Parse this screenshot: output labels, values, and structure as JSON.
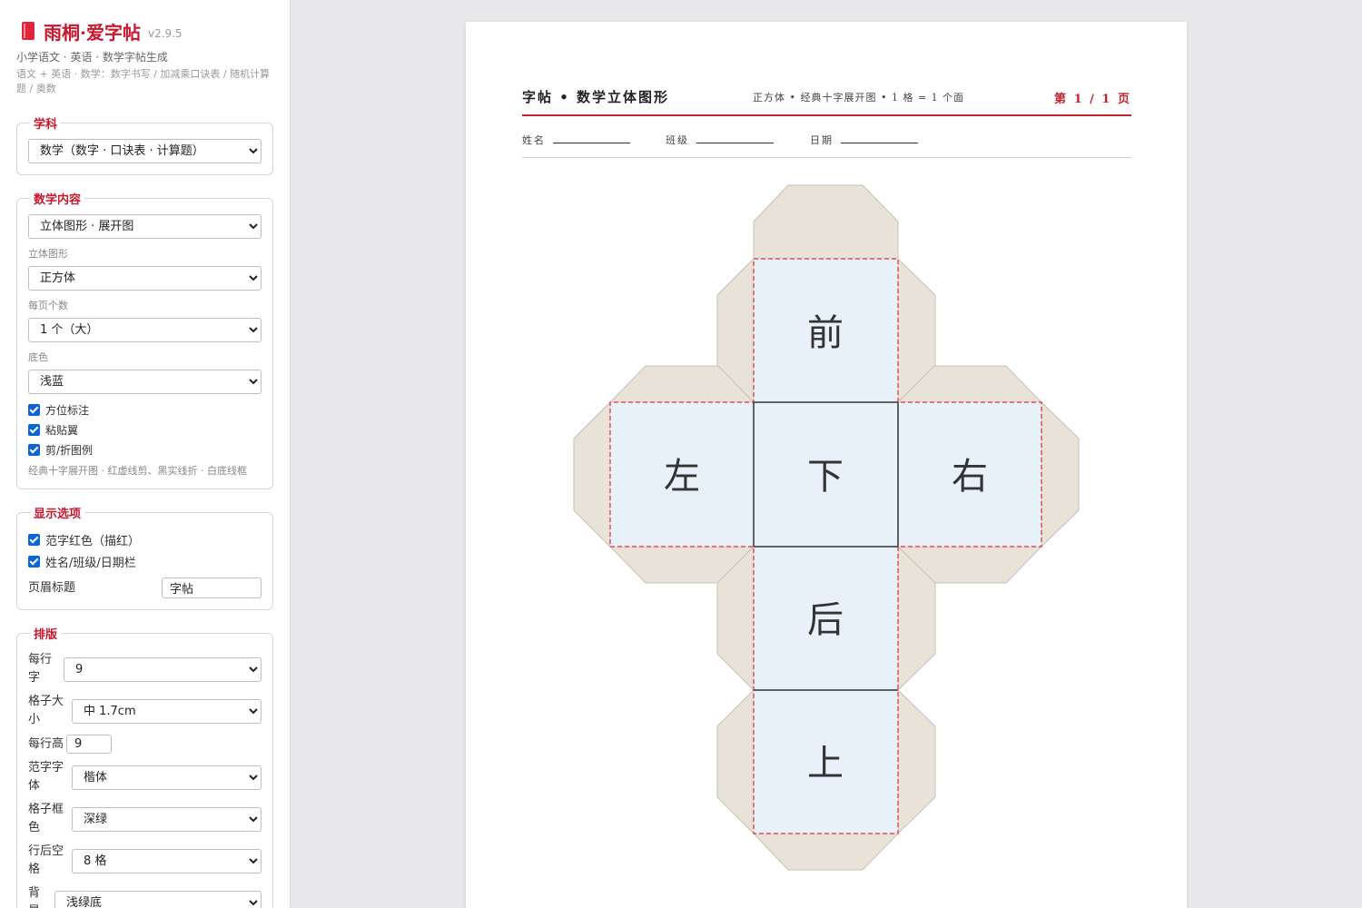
{
  "app": {
    "name": "雨桐·爱字帖",
    "version": "v2.9.5",
    "subtitle": "小学语文 · 英语 · 数学字帖生成",
    "description": "语文 + 英语 · 数学：数字书写 / 加减乘口诀表 / 随机计算题 / 奥数"
  },
  "subject": {
    "legend": "学科",
    "value": "数学（数字 · 口诀表 · 计算题）"
  },
  "math": {
    "legend": "数学内容",
    "content_value": "立体图形 · 展开图",
    "shape_label": "立体图形",
    "shape_value": "正方体",
    "per_page_label": "每页个数",
    "per_page_value": "1 个（大）",
    "bg_label": "底色",
    "bg_value": "浅蓝",
    "checks": [
      "方位标注",
      "粘贴翼",
      "剪/折图例"
    ],
    "hint": "经典十字展开图 · 红虚线剪、黑实线折 · 白底线框"
  },
  "display": {
    "legend": "显示选项",
    "checks": [
      "范字红色（描红）",
      "姓名/班级/日期栏"
    ],
    "header_title_label": "页眉标题",
    "header_title_value": "字帖"
  },
  "layout": {
    "legend": "排版",
    "per_row_label": "每行字",
    "per_row_value": "9",
    "grid_size_label": "格子大小",
    "grid_size_value": "中 1.7cm",
    "row_height_label": "每行高",
    "row_height_value": "9",
    "font_label": "范字字体",
    "font_value": "楷体",
    "grid_color_label": "格子框色",
    "grid_color_value": "深绿",
    "gap_label": "行后空格",
    "gap_value": "8 格",
    "bg_label": "背景",
    "bg_value": "浅绿底"
  },
  "paper": {
    "title": "字帖 • 数学立体图形",
    "meta": "正方体 • 经典十字展开图 • 1 格 = 1 个面",
    "page": "第 1 / 1 页",
    "name_label": "姓名",
    "class_label": "班级",
    "date_label": "日期",
    "faces": {
      "front": "前",
      "left": "左",
      "bottom": "下",
      "right": "右",
      "back": "后",
      "top": "上"
    }
  },
  "colors": {
    "accent": "#c8182d",
    "face_fill": "#e8f0fa",
    "tab_fill": "#e8e2d8",
    "cut_line": "#e05050",
    "fold_line": "#333333"
  }
}
